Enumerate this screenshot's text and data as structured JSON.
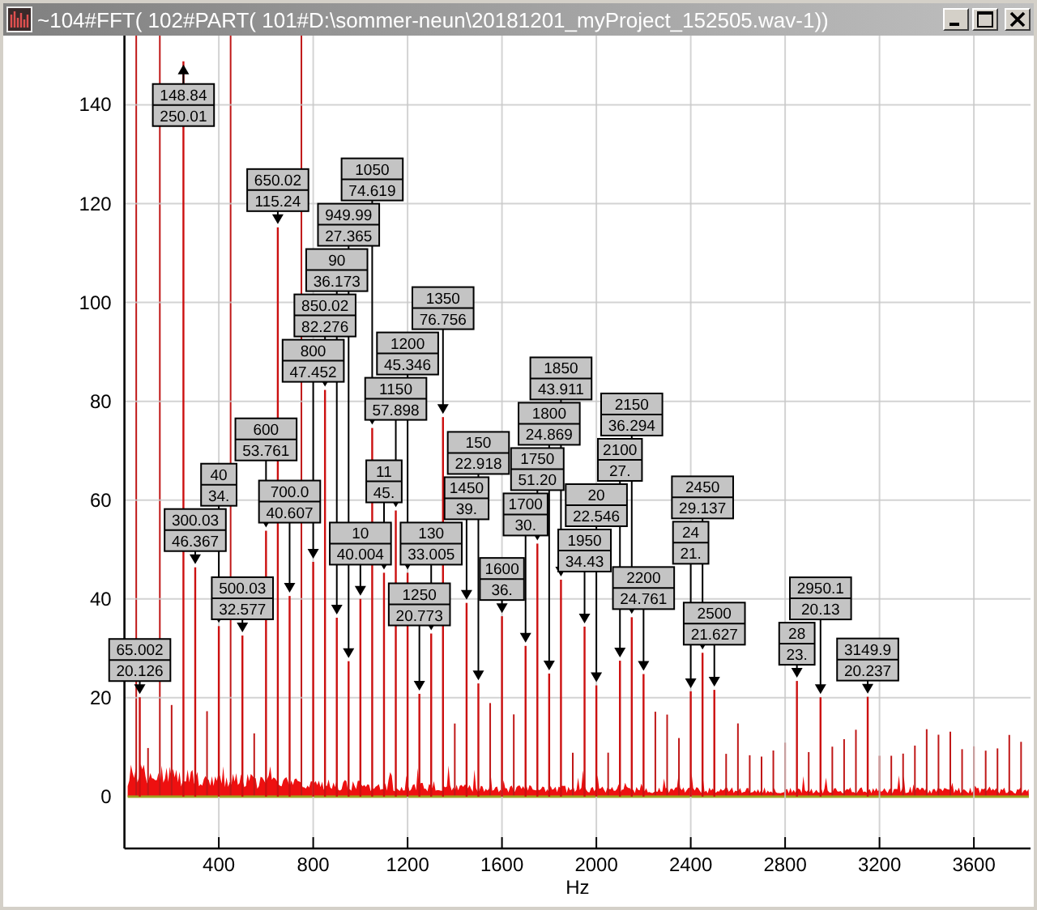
{
  "window": {
    "title": "~104#FFT( 102#PART( 101#D:\\sommer-neun\\20181201_myProject_152505.wav-1))"
  },
  "chart_data": {
    "type": "bar",
    "xlabel": "Hz",
    "xlim": [
      0,
      3840
    ],
    "ylim": [
      -10.5,
      154
    ],
    "grid": true,
    "xticks": [
      400,
      800,
      1200,
      1600,
      2000,
      2400,
      2800,
      3200,
      3600
    ],
    "yticks": [
      0,
      20,
      40,
      60,
      80,
      100,
      120,
      140
    ],
    "x": [
      65,
      250,
      300,
      400,
      500,
      600,
      650,
      700,
      800,
      850,
      900,
      950,
      1000,
      1050,
      1100,
      1150,
      1200,
      1250,
      1300,
      1350,
      1450,
      1500,
      1600,
      1700,
      1750,
      1800,
      1850,
      1950,
      2000,
      2100,
      2150,
      2200,
      2400,
      2450,
      2500,
      2850,
      2950,
      3150
    ],
    "series": [
      {
        "color": "#cc1010",
        "values": [
          20.1,
          148.8,
          46.4,
          34.5,
          32.6,
          53.8,
          115.2,
          40.6,
          47.5,
          82.3,
          36.2,
          27.4,
          40,
          74.6,
          45.3,
          57.9,
          45.3,
          20.8,
          33,
          76.8,
          39.2,
          22.9,
          36.5,
          30.5,
          51.2,
          24.9,
          43.9,
          34.4,
          22.5,
          27.5,
          36.3,
          24.8,
          21.3,
          29.1,
          21.6,
          23.4,
          20.1,
          20.2
        ]
      }
    ],
    "annotations": [
      {
        "text": "65.002\n20.126"
      },
      {
        "text": "148.84\n250.01"
      },
      {
        "text": "300.03\n46.367"
      },
      {
        "text": "40\n34."
      },
      {
        "text": "500.03\n32.577"
      },
      {
        "text": "600\n53.761"
      },
      {
        "text": "650.02\n115.24"
      },
      {
        "text": "700.0\n40.607"
      },
      {
        "text": "800\n47.452"
      },
      {
        "text": "850.02\n82.276"
      },
      {
        "text": "90\n36.173"
      },
      {
        "text": "949.99\n27.365"
      },
      {
        "text": "10\n40.004"
      },
      {
        "text": "1050\n74.619"
      },
      {
        "text": "11\n45."
      },
      {
        "text": "1150\n57.898"
      },
      {
        "text": "1200\n45.346"
      },
      {
        "text": "1250\n20.773"
      },
      {
        "text": "130\n33.005"
      },
      {
        "text": "1350\n76.756"
      },
      {
        "text": "1450\n39."
      },
      {
        "text": "150\n22.918"
      },
      {
        "text": "1600\n36."
      },
      {
        "text": "1700\n30."
      },
      {
        "text": "1750\n51.20"
      },
      {
        "text": "1800\n24.869"
      },
      {
        "text": "1850\n43.911"
      },
      {
        "text": "1950\n34.43"
      },
      {
        "text": "20\n22.546"
      },
      {
        "text": "2100\n27."
      },
      {
        "text": "2150\n36.294"
      },
      {
        "text": "2200\n24.761"
      },
      {
        "text": "24\n21."
      },
      {
        "text": "2450\n29.137"
      },
      {
        "text": "2500\n21.627"
      },
      {
        "text": "28\n23."
      },
      {
        "text": "2950.1\n20.13"
      },
      {
        "text": "3149.9\n20.237"
      }
    ]
  }
}
